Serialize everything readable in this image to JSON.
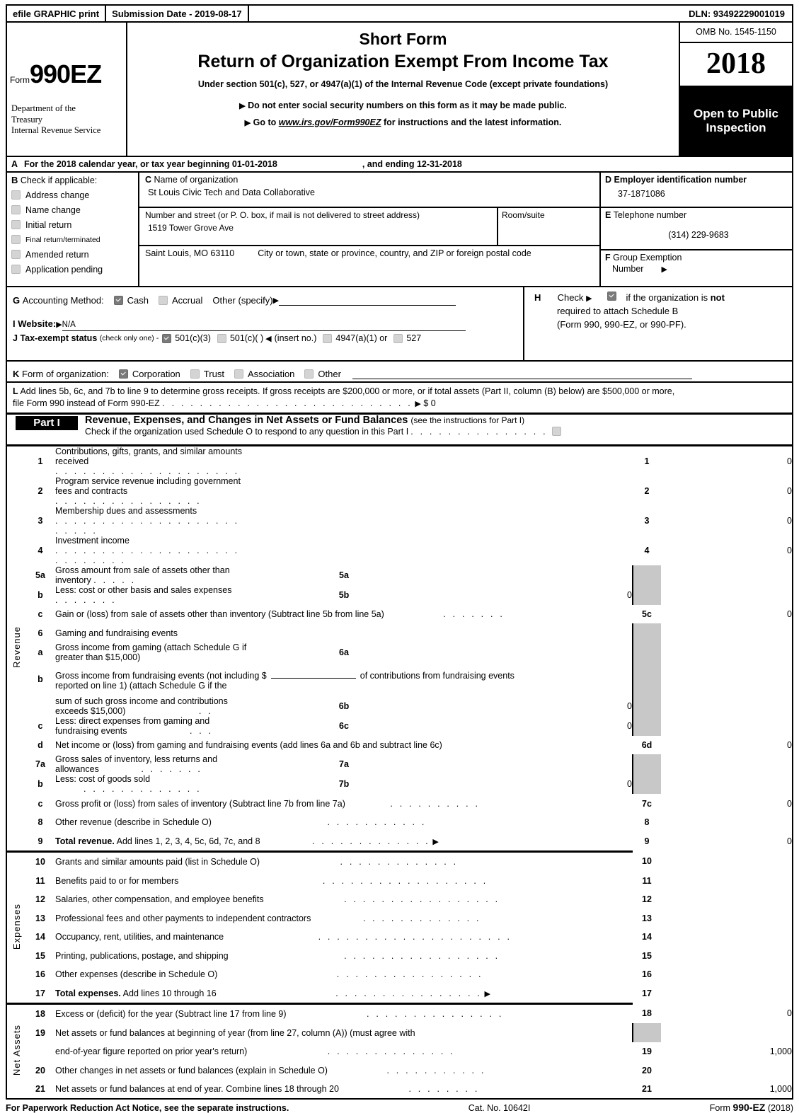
{
  "efile": {
    "graphic_print": "efile GRAPHIC print",
    "submission_date": "Submission Date - 2019-08-17",
    "dln": "DLN: 93492229001019"
  },
  "masthead": {
    "form_label": "Form",
    "form_number": "990EZ",
    "department_line1": "Department of the",
    "department_line2": "Treasury",
    "department_line3": "Internal Revenue Service",
    "title_short": "Short Form",
    "title_main": "Return of Organization Exempt From Income Tax",
    "subtitle": "Under section 501(c), 527, or 4947(a)(1) of the Internal Revenue Code (except private foundations)",
    "bullet1": "Do not enter social security numbers on this form as it may be made public.",
    "bullet2_pre": "Go to",
    "bullet2_link": "www.irs.gov/Form990EZ",
    "bullet2_post": "for instructions and the latest information.",
    "omb": "OMB No. 1545-1150",
    "year": "2018",
    "open_public_1": "Open to Public",
    "open_public_2": "Inspection"
  },
  "line_a": {
    "letter": "A",
    "text_pre": "For the 2018 calendar year, or tax year beginning",
    "begin_date": "01-01-2018",
    "text_mid": ", and ending",
    "end_date": "12-31-2018"
  },
  "box_b": {
    "letter": "B",
    "heading": "Check if applicable:",
    "items": [
      {
        "label": "Address change",
        "checked": false
      },
      {
        "label": "Name change",
        "checked": false
      },
      {
        "label": "Initial return",
        "checked": false
      },
      {
        "label": "Final return/terminated",
        "checked": false
      },
      {
        "label": "Amended return",
        "checked": false
      },
      {
        "label": "Application pending",
        "checked": false
      }
    ]
  },
  "box_c": {
    "letter": "C",
    "name_label": "Name of organization",
    "org_name": "St Louis Civic Tech and Data Collaborative",
    "street_label": "Number and street (or P. O. box, if mail is not delivered to street address)",
    "street": "1519 Tower Grove Ave",
    "room_label": "Room/suite",
    "room": "",
    "city_value": "Saint Louis, MO   63110",
    "city_label": "City or town, state or province, country, and ZIP or foreign postal code"
  },
  "box_d": {
    "letter": "D",
    "label": "Employer identification number",
    "value": "37-1871086"
  },
  "box_e": {
    "letter": "E",
    "label": "Telephone number",
    "value": "(314) 229-9683"
  },
  "box_f": {
    "letter": "F",
    "label_line1": "Group Exemption",
    "label_line2": "Number",
    "value": ""
  },
  "line_g": {
    "letter": "G",
    "label": "Accounting Method:",
    "cash": "Cash",
    "cash_checked": true,
    "accrual": "Accrual",
    "accrual_checked": false,
    "other": "Other (specify)",
    "other_value": ""
  },
  "box_h": {
    "letter": "H",
    "check_label": "Check",
    "checked": true,
    "text1_pre": "if the organization is",
    "text1_bold": "not",
    "text2": "required to attach Schedule B",
    "text3": "(Form 990, 990-EZ, or 990-PF)."
  },
  "line_i": {
    "letter": "I",
    "label": "Website:",
    "value": "N/A"
  },
  "line_j": {
    "letter": "J",
    "label": "Tax-exempt status",
    "hint": "(check only one) -",
    "opt1": "501(c)(3)",
    "opt1_checked": true,
    "opt2": "501(c)(   )",
    "opt2_checked": false,
    "insert": "(insert no.)",
    "opt3": "4947(a)(1) or",
    "opt3_checked": false,
    "opt4": "527",
    "opt4_checked": false
  },
  "line_k": {
    "letter": "K",
    "label": "Form of organization:",
    "opt1": "Corporation",
    "opt1_checked": true,
    "opt2": "Trust",
    "opt2_checked": false,
    "opt3": "Association",
    "opt3_checked": false,
    "opt4": "Other",
    "opt4_checked": false,
    "other_value": ""
  },
  "line_l": {
    "letter": "L",
    "text_line1": "Add lines 5b, 6c, and 7b to line 9 to determine gross receipts. If gross receipts are $200,000 or more, or if total assets (Part II, column (B) below) are $500,000 or more,",
    "text_line2": "file Form 990 instead of Form 990-EZ",
    "amount": "$ 0"
  },
  "part1": {
    "tag": "Part I",
    "title": "Revenue, Expenses, and Changes in Net Assets or Fund Balances",
    "title_note": "(see the instructions for Part I)",
    "check_schedule_o": "Check if the organization used Schedule O to respond to any question in this Part I",
    "schedule_o_checked": false,
    "section_labels": {
      "revenue": "Revenue",
      "expenses": "Expenses",
      "net_assets": "Net Assets"
    },
    "rows": [
      {
        "num": "1",
        "desc": "Contributions, gifts, grants, and similar amounts received",
        "leader_dots": 20,
        "rnum": "1",
        "rval": "0"
      },
      {
        "num": "2",
        "desc": "Program service revenue including government fees and contracts",
        "leader_dots": 16,
        "rnum": "2",
        "rval": "0"
      },
      {
        "num": "3",
        "desc": "Membership dues and assessments",
        "leader_dots": 25,
        "rnum": "3",
        "rval": "0"
      },
      {
        "num": "4",
        "desc": "Investment income",
        "leader_dots": 28,
        "rnum": "4",
        "rval": "0"
      },
      {
        "num": "5a",
        "desc": "Gross amount from sale of assets other than inventory",
        "leader_dots": 5,
        "midnum": "5a",
        "midval": "",
        "rnum": "",
        "rval": "",
        "grey": true
      },
      {
        "num": "b",
        "sub": true,
        "desc": "Less: cost or other basis and sales expenses",
        "leader_dots": 7,
        "midnum": "5b",
        "midval": "0",
        "rnum": "",
        "rval": "",
        "grey": true
      },
      {
        "num": "c",
        "sub": true,
        "desc": "Gain or (loss) from sale of assets other than inventory (Subtract line 5b from line 5a)",
        "leader_dots": 7,
        "rnum": "5c",
        "rval": "0"
      },
      {
        "num": "6",
        "desc": "Gaming and fundraising events",
        "leader_dots": 0,
        "rnum": "",
        "rval": "",
        "grey": true
      },
      {
        "num": "a",
        "sub": true,
        "desc": "Gross income from gaming (attach Schedule G if greater than $15,000)",
        "leader_dots": 0,
        "midnum": "6a",
        "midval": "",
        "rnum": "",
        "rval": "",
        "grey": true
      },
      {
        "num": "b",
        "sub": true,
        "desc_special": "fundraising_b",
        "desc": "Gross income from fundraising events (not including $",
        "desc_cont": "of contributions from fundraising events",
        "desc_line2": "reported on line 1) (attach Schedule G if the",
        "rnum": "",
        "rval": "",
        "grey": true
      },
      {
        "num": "",
        "desc": "sum of such gross income and contributions exceeds $15,000)",
        "leader_dots": 2,
        "midnum": "6b",
        "midval": "0",
        "rnum": "",
        "rval": "",
        "grey": true
      },
      {
        "num": "c",
        "sub": true,
        "desc": "Less: direct expenses from gaming and fundraising events",
        "leader_dots": 3,
        "midnum": "6c",
        "midval": "0",
        "rnum": "",
        "rval": "",
        "grey": true
      },
      {
        "num": "d",
        "sub": true,
        "desc": "Net income or (loss) from gaming and fundraising events (add lines 6a and 6b and subtract line 6c)",
        "leader_dots": 0,
        "rnum": "6d",
        "rval": "0"
      },
      {
        "num": "7a",
        "desc": "Gross sales of inventory, less returns and allowances",
        "leader_dots": 7,
        "midnum": "7a",
        "midval": "",
        "rnum": "",
        "rval": "",
        "grey": true
      },
      {
        "num": "b",
        "sub": true,
        "desc": "Less: cost of goods sold",
        "leader_dots": 13,
        "midnum": "7b",
        "midval": "0",
        "rnum": "",
        "rval": "",
        "grey": true
      },
      {
        "num": "c",
        "sub": true,
        "desc": "Gross profit or (loss) from sales of inventory (Subtract line 7b from line 7a)",
        "leader_dots": 10,
        "rnum": "7c",
        "rval": "0"
      },
      {
        "num": "8",
        "desc": "Other revenue (describe in Schedule O)",
        "leader_dots": 11,
        "rnum": "8",
        "rval": ""
      },
      {
        "num": "9",
        "desc_bold": "Total revenue.",
        "desc": "Add lines 1, 2, 3, 4, 5c, 6d, 7c, and 8",
        "leader_dots": 13,
        "arrow": true,
        "rnum": "9",
        "rval": "0"
      },
      {
        "num": "10",
        "desc": "Grants and similar amounts paid (list in Schedule O)",
        "leader_dots": 13,
        "rnum": "10",
        "rval": "",
        "section": "expenses"
      },
      {
        "num": "11",
        "desc": "Benefits paid to or for members",
        "leader_dots": 18,
        "rnum": "11",
        "rval": ""
      },
      {
        "num": "12",
        "desc": "Salaries, other compensation, and employee benefits",
        "leader_dots": 17,
        "rnum": "12",
        "rval": ""
      },
      {
        "num": "13",
        "desc": "Professional fees and other payments to independent contractors",
        "leader_dots": 13,
        "rnum": "13",
        "rval": ""
      },
      {
        "num": "14",
        "desc": "Occupancy, rent, utilities, and maintenance",
        "leader_dots": 21,
        "rnum": "14",
        "rval": ""
      },
      {
        "num": "15",
        "desc": "Printing, publications, postage, and shipping",
        "leader_dots": 17,
        "rnum": "15",
        "rval": ""
      },
      {
        "num": "16",
        "desc": "Other expenses (describe in Schedule O)",
        "leader_dots": 16,
        "rnum": "16",
        "rval": ""
      },
      {
        "num": "17",
        "desc_bold": "Total expenses.",
        "desc": "Add lines 10 through 16",
        "leader_dots": 16,
        "arrow": true,
        "rnum": "17",
        "rval": ""
      },
      {
        "num": "18",
        "desc": "Excess or (deficit) for the year (Subtract line 17 from line 9)",
        "leader_dots": 15,
        "rnum": "18",
        "rval": "0",
        "section": "net_assets"
      },
      {
        "num": "19",
        "desc": "Net assets or fund balances at beginning of year (from line 27, column (A)) (must agree with",
        "leader_dots": 0,
        "rnum": "",
        "rval": "",
        "grey": true
      },
      {
        "num": "",
        "desc": "end-of-year figure reported on prior year's return)",
        "leader_dots": 14,
        "rnum": "19",
        "rval": "1,000"
      },
      {
        "num": "20",
        "desc": "Other changes in net assets or fund balances (explain in Schedule O)",
        "leader_dots": 11,
        "rnum": "20",
        "rval": ""
      },
      {
        "num": "21",
        "desc": "Net assets or fund balances at end of year. Combine lines 18 through 20",
        "leader_dots": 8,
        "rnum": "21",
        "rval": "1,000"
      }
    ]
  },
  "footer": {
    "left": "For Paperwork Reduction Act Notice, see the separate instructions.",
    "center": "Cat. No. 10642I",
    "right_pre": "Form",
    "right_bold": "990-EZ",
    "right_post": "(2018)"
  }
}
